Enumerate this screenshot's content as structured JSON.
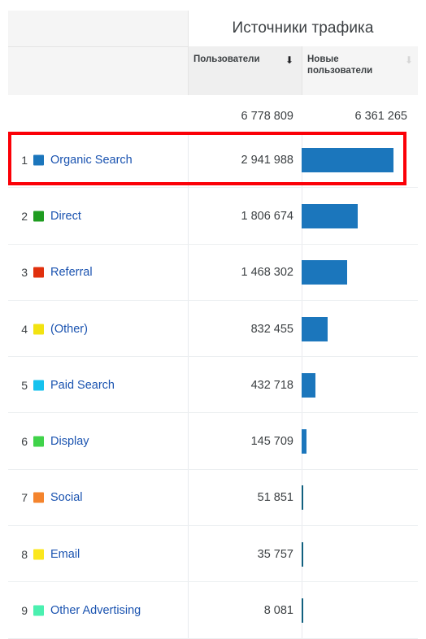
{
  "report": {
    "group_title": "Источники трафика",
    "columns": [
      {
        "id": "channel",
        "header": ""
      },
      {
        "id": "users",
        "header": "Пользователи",
        "sort_icon": "arrow-down-icon",
        "sort_active": true
      },
      {
        "id": "new_users",
        "header": "Новые пользователи",
        "sort_icon": "arrow-down-icon",
        "sort_active": false
      }
    ],
    "totals": {
      "users": "6 778 809",
      "new_users": "6 361 265"
    },
    "highlight": {
      "row_index": 0,
      "color": "#fb0007"
    },
    "bar_color": "#1b76bc",
    "link_color": "#1a53b0",
    "rows": [
      {
        "rank": "1",
        "label": "Organic Search",
        "swatch": "#1b76bc",
        "value": "2 941 988",
        "numeric": 2941988
      },
      {
        "rank": "2",
        "label": "Direct",
        "swatch": "#1f9c20",
        "value": "1 806 674",
        "numeric": 1806674
      },
      {
        "rank": "3",
        "label": "Referral",
        "swatch": "#e1300d",
        "value": "1 468 302",
        "numeric": 1468302
      },
      {
        "rank": "4",
        "label": "(Other)",
        "swatch": "#f2e311",
        "value": "832 455",
        "numeric": 832455
      },
      {
        "rank": "5",
        "label": "Paid Search",
        "swatch": "#15c2ee",
        "value": "432 718",
        "numeric": 432718
      },
      {
        "rank": "6",
        "label": "Display",
        "swatch": "#40d34a",
        "value": "145 709",
        "numeric": 145709
      },
      {
        "rank": "7",
        "label": "Social",
        "swatch": "#f4842d",
        "value": "51 851",
        "numeric": 51851
      },
      {
        "rank": "8",
        "label": "Email",
        "swatch": "#fbe71d",
        "value": "35 757",
        "numeric": 35757
      },
      {
        "rank": "9",
        "label": "Other Advertising",
        "swatch": "#4bf0b0",
        "value": "8 081",
        "numeric": 8081
      }
    ]
  },
  "chart_data": {
    "type": "bar",
    "title": "Источники трафика",
    "xlabel": "Пользователи",
    "ylabel": "",
    "categories": [
      "Organic Search",
      "Direct",
      "Referral",
      "(Other)",
      "Paid Search",
      "Display",
      "Social",
      "Email",
      "Other Advertising"
    ],
    "series": [
      {
        "name": "Пользователи",
        "values": [
          2941988,
          1806674,
          1468302,
          832455,
          432718,
          145709,
          51851,
          35757,
          8081
        ]
      }
    ],
    "totals": {
      "Пользователи": 6778809,
      "Новые пользователи": 6361265
    },
    "xlim": [
      0,
      2941988
    ],
    "grid": true,
    "legend": "none"
  }
}
